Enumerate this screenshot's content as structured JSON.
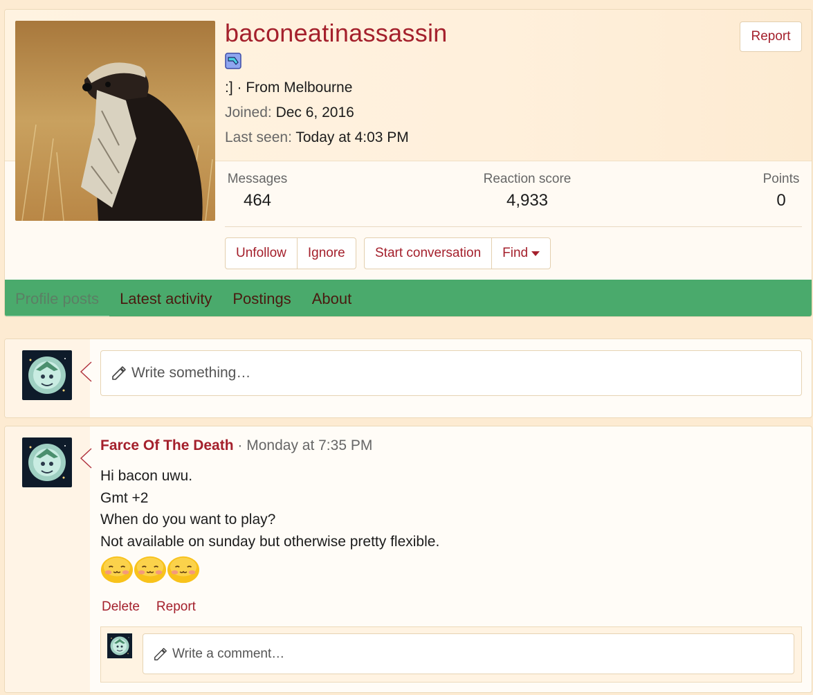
{
  "profile": {
    "username": "baconeatinassassin",
    "about_line": ":] · From Melbourne",
    "joined_label": "Joined:",
    "joined_value": "Dec 6, 2016",
    "last_seen_label": "Last seen:",
    "last_seen_value": "Today at 4:03 PM",
    "report_label": "Report",
    "stats": {
      "messages_label": "Messages",
      "messages_value": "464",
      "reaction_label": "Reaction score",
      "reaction_value": "4,933",
      "points_label": "Points",
      "points_value": "0"
    },
    "actions": {
      "unfollow": "Unfollow",
      "ignore": "Ignore",
      "start_conversation": "Start conversation",
      "find": "Find"
    }
  },
  "tabs": [
    "Profile posts",
    "Latest activity",
    "Postings",
    "About"
  ],
  "composer": {
    "placeholder": "Write something…"
  },
  "post": {
    "author": "Farce Of The Death",
    "separator": " · ",
    "time": "Monday at 7:35 PM",
    "lines": [
      "Hi bacon uwu.",
      "Gmt +2",
      "When do you want to play?",
      "Not available on sunday but otherwise pretty flexible."
    ],
    "delete_label": "Delete",
    "report_label": "Report",
    "comment_placeholder": "Write a comment…"
  },
  "colors": {
    "accent": "#a4202c",
    "tab_bar": "#4aaa6c",
    "background": "#fdebd2"
  },
  "icons": {
    "pencil": "pencil-icon",
    "caret": "caret-down-icon",
    "badge": "chat-badge-icon"
  }
}
